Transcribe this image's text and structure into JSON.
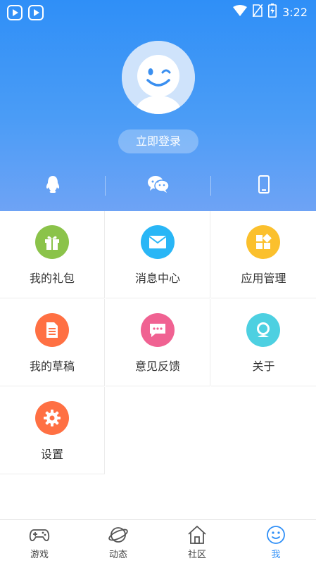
{
  "status_bar": {
    "time": "3:22",
    "icons": [
      "video-app-icon",
      "video-app-icon",
      "wifi-icon",
      "no-sim-icon",
      "battery-charging-icon"
    ]
  },
  "profile": {
    "login_label": "立即登录"
  },
  "social_login": [
    "qq-icon",
    "wechat-icon",
    "phone-icon"
  ],
  "menu": {
    "items": [
      {
        "label": "我的礼包",
        "icon": "gift-icon",
        "color": "#8bc34a"
      },
      {
        "label": "消息中心",
        "icon": "mail-icon",
        "color": "#29b6f6"
      },
      {
        "label": "应用管理",
        "icon": "apps-icon",
        "color": "#fbc02d"
      },
      {
        "label": "我的草稿",
        "icon": "draft-icon",
        "color": "#ff7043"
      },
      {
        "label": "意见反馈",
        "icon": "feedback-icon",
        "color": "#f06292"
      },
      {
        "label": "关于",
        "icon": "about-icon",
        "color": "#4dd0e1"
      },
      {
        "label": "设置",
        "icon": "gear-icon",
        "color": "#ff7043"
      }
    ]
  },
  "bottom_nav": {
    "items": [
      {
        "label": "游戏",
        "icon": "gamepad-icon"
      },
      {
        "label": "动态",
        "icon": "planet-icon"
      },
      {
        "label": "社区",
        "icon": "home-icon"
      },
      {
        "label": "我",
        "icon": "smiley-icon",
        "active": true
      }
    ]
  },
  "colors": {
    "header_top": "#2f8ff7",
    "header_bottom": "#6ea3f5",
    "active_tab": "#2f8ff7"
  }
}
